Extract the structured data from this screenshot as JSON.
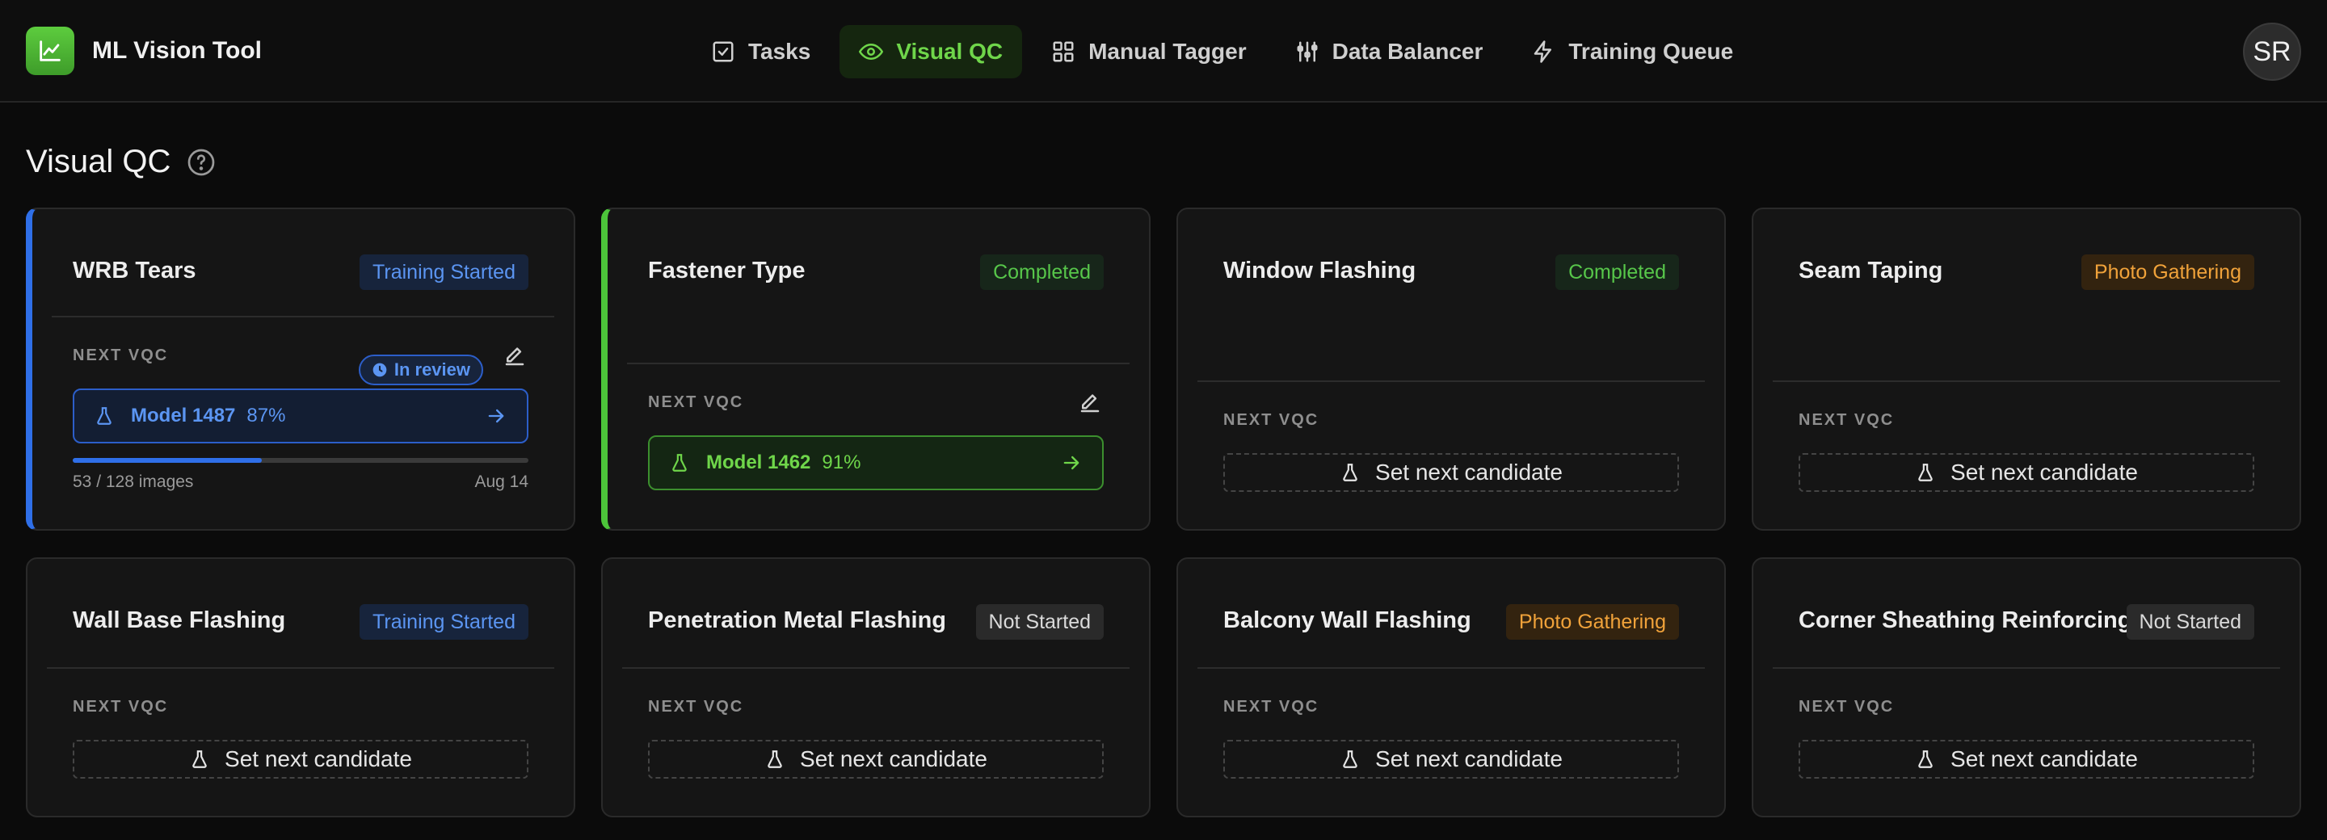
{
  "app": {
    "title": "ML Vision Tool"
  },
  "nav": [
    {
      "label": "Tasks",
      "icon": "checkbox-icon"
    },
    {
      "label": "Visual QC",
      "icon": "eye-icon",
      "active": true
    },
    {
      "label": "Manual Tagger",
      "icon": "grid-icon"
    },
    {
      "label": "Data Balancer",
      "icon": "sliders-icon"
    },
    {
      "label": "Training Queue",
      "icon": "bolt-icon"
    }
  ],
  "user": {
    "initials": "SR"
  },
  "page": {
    "title": "Visual QC"
  },
  "labels": {
    "next_vqc": "NEXT VQC",
    "set_next": "Set next candidate"
  },
  "colors": {
    "accent_green": "#4cc43a",
    "accent_blue": "#2f6fe8",
    "orange": "#f0a23a"
  },
  "cards": [
    {
      "title": "WRB Tears",
      "status": "Training Started",
      "review": "In review",
      "model": {
        "name": "Model 1487",
        "confidence": "87%"
      },
      "progress": {
        "text": "53 / 128 images",
        "done": 53,
        "total": 128,
        "date": "Aug 14"
      }
    },
    {
      "title": "Fastener Type",
      "status": "Completed",
      "model": {
        "name": "Model 1462",
        "confidence": "91%"
      }
    },
    {
      "title": "Window Flashing",
      "status": "Completed"
    },
    {
      "title": "Seam Taping",
      "status": "Photo Gathering"
    },
    {
      "title": "Wall Base Flashing",
      "status": "Training Started"
    },
    {
      "title": "Penetration Metal Flashing",
      "status": "Not Started"
    },
    {
      "title": "Balcony Wall Flashing",
      "status": "Photo Gathering"
    },
    {
      "title": "Corner Sheathing Reinforcing",
      "status": "Not Started"
    }
  ]
}
